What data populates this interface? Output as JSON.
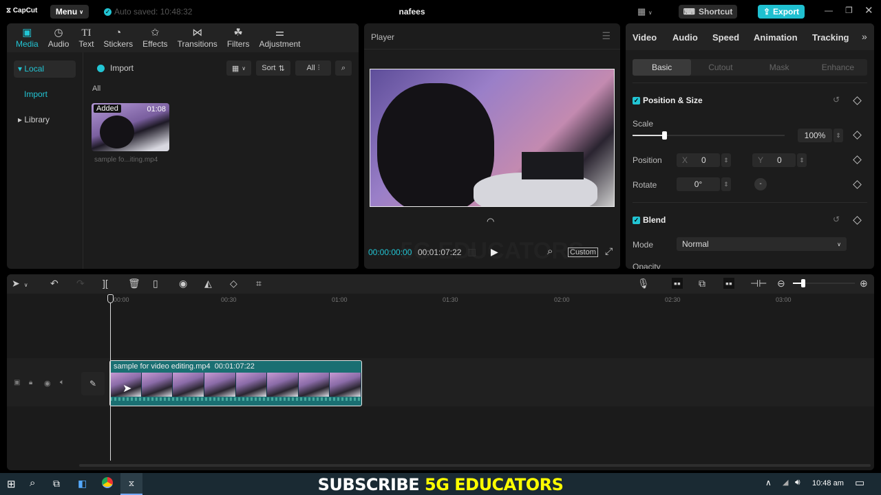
{
  "titlebar": {
    "app_name": "CapCut",
    "menu": "Menu",
    "autosave": "Auto saved: 10:48:32",
    "project_title": "nafees",
    "shortcut": "Shortcut",
    "export": "Export"
  },
  "media_panel": {
    "tabs": [
      {
        "label": "Media",
        "icon": "media-icon"
      },
      {
        "label": "Audio",
        "icon": "audio-icon"
      },
      {
        "label": "Text",
        "icon": "text-icon"
      },
      {
        "label": "Stickers",
        "icon": "stickers-icon"
      },
      {
        "label": "Effects",
        "icon": "effects-icon"
      },
      {
        "label": "Transitions",
        "icon": "transitions-icon"
      },
      {
        "label": "Filters",
        "icon": "filters-icon"
      },
      {
        "label": "Adjustment",
        "icon": "adjustment-icon"
      }
    ],
    "sidebar": {
      "local": "Local",
      "import": "Import",
      "library": "Library"
    },
    "import_button": "Import",
    "sort": "Sort",
    "filter_all": "All",
    "section": "All",
    "media_item": {
      "badge": "Added",
      "duration": "01:08",
      "filename": "sample fo...iting.mp4"
    }
  },
  "player": {
    "title": "Player",
    "current_time": "00:00:00:00",
    "total_time": "00:01:07:22",
    "ratio": "Custom",
    "watermark": "5G EDUCATORS"
  },
  "properties": {
    "tabs": [
      "Video",
      "Audio",
      "Speed",
      "Animation",
      "Tracking"
    ],
    "subtabs": [
      "Basic",
      "Cutout",
      "Mask",
      "Enhance"
    ],
    "position_size": {
      "title": "Position & Size",
      "scale_label": "Scale",
      "scale_value": "100%",
      "scale_percent": 100,
      "position_label": "Position",
      "x_label": "X",
      "x_value": "0",
      "y_label": "Y",
      "y_value": "0",
      "rotate_label": "Rotate",
      "rotate_value": "0°"
    },
    "blend": {
      "title": "Blend",
      "mode_label": "Mode",
      "mode_value": "Normal",
      "opacity_label": "Opacity"
    }
  },
  "timeline": {
    "ticks": [
      "00:00",
      "00:30",
      "01:00",
      "01:30",
      "02:00",
      "02:30",
      "03:00"
    ],
    "clip": {
      "name": "sample for video editing.mp4",
      "duration": "00:01:07:22"
    }
  },
  "taskbar": {
    "banner_white": "SUBSCRIBE",
    "banner_yellow": "5G EDUCATORS",
    "clock": "10:48 am"
  },
  "colors": {
    "accent": "#22c5d4",
    "clip": "#1a6f72",
    "banner_yellow": "#ffff00"
  }
}
